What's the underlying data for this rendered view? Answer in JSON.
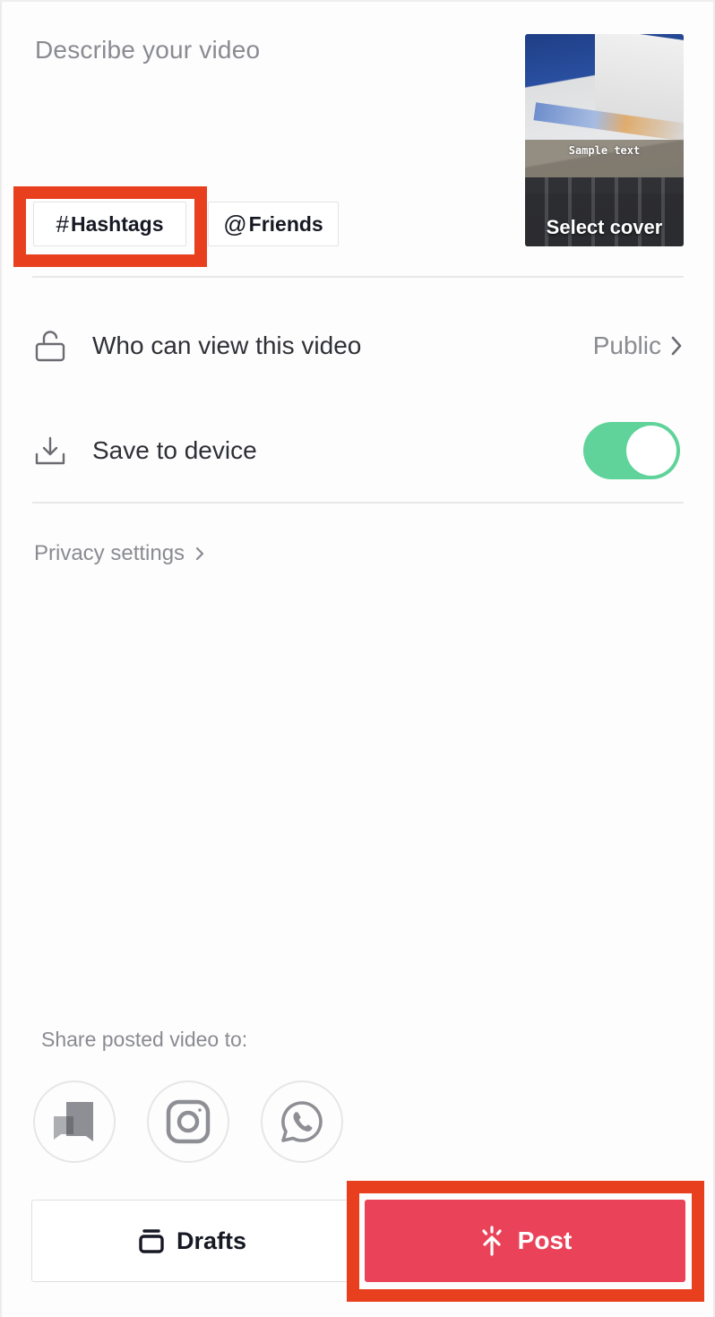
{
  "description": {
    "placeholder": "Describe your video"
  },
  "chips": {
    "hashtags": {
      "glyph": "#",
      "label": "Hashtags"
    },
    "friends": {
      "glyph": "@",
      "label": "Friends"
    }
  },
  "cover": {
    "overlay_text": "Sample text",
    "label": "Select cover"
  },
  "settings": {
    "who_can_view": {
      "label": "Who can view this video",
      "value": "Public",
      "icon": "lock-open-icon"
    },
    "save_to_device": {
      "label": "Save to device",
      "enabled": true,
      "icon": "download-icon"
    },
    "privacy_link": "Privacy settings"
  },
  "share": {
    "label": "Share posted video to:",
    "targets": [
      {
        "name": "messages",
        "icon": "chat-bubbles-icon"
      },
      {
        "name": "instagram",
        "icon": "instagram-icon"
      },
      {
        "name": "whatsapp",
        "icon": "whatsapp-icon"
      }
    ]
  },
  "actions": {
    "drafts_label": "Drafts",
    "post_label": "Post"
  },
  "colors": {
    "accent": "#ea4359",
    "toggle_on": "#5fd39a",
    "highlight": "#e8401e",
    "muted_text": "#8a8b91"
  }
}
